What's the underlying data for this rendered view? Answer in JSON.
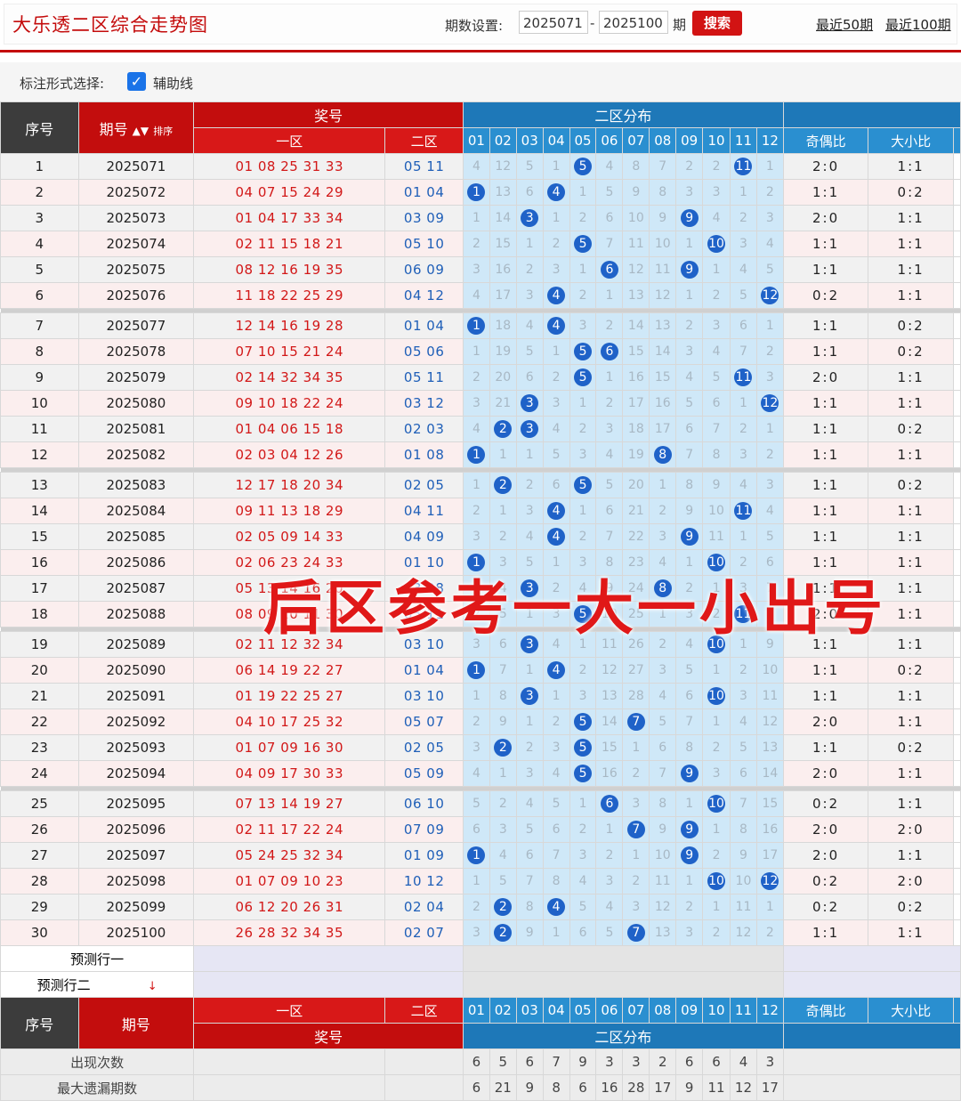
{
  "header": {
    "title": "大乐透二区综合走势图",
    "period_label": "期数设置:",
    "period_start": "2025071",
    "period_end": "2025100",
    "period_unit": "期",
    "search_label": "搜索",
    "quick_links": [
      "最近50期",
      "最近100期"
    ]
  },
  "options": {
    "label": "标注形式选择:",
    "checkbox_label": "辅助线",
    "checked": true
  },
  "table_header": {
    "seq": "序号",
    "period": "期号",
    "sort": "排序",
    "prize": "奖号",
    "zone1": "一区",
    "zone2": "二区",
    "dist": "二区分布",
    "numbers": [
      "01",
      "02",
      "03",
      "04",
      "05",
      "06",
      "07",
      "08",
      "09",
      "10",
      "11",
      "12"
    ],
    "odd_even": "奇偶比",
    "big_small": "大小比"
  },
  "rows": [
    {
      "seq": "1",
      "period": "2025071",
      "front": "01 08 25 31 33",
      "back": "05 11",
      "cells": [
        "4",
        "12",
        "5",
        "1",
        "●5",
        "4",
        "8",
        "7",
        "2",
        "2",
        "●11",
        "1"
      ],
      "oe": "2:0",
      "bs": "1:1"
    },
    {
      "seq": "2",
      "period": "2025072",
      "front": "04 07 15 24 29",
      "back": "01 04",
      "cells": [
        "●1",
        "13",
        "6",
        "●4",
        "1",
        "5",
        "9",
        "8",
        "3",
        "3",
        "1",
        "2"
      ],
      "oe": "1:1",
      "bs": "0:2"
    },
    {
      "seq": "3",
      "period": "2025073",
      "front": "01 04 17 33 34",
      "back": "03 09",
      "cells": [
        "1",
        "14",
        "●3",
        "1",
        "2",
        "6",
        "10",
        "9",
        "●9",
        "4",
        "2",
        "3"
      ],
      "oe": "2:0",
      "bs": "1:1"
    },
    {
      "seq": "4",
      "period": "2025074",
      "front": "02 11 15 18 21",
      "back": "05 10",
      "cells": [
        "2",
        "15",
        "1",
        "2",
        "●5",
        "7",
        "11",
        "10",
        "1",
        "●10",
        "3",
        "4"
      ],
      "oe": "1:1",
      "bs": "1:1"
    },
    {
      "seq": "5",
      "period": "2025075",
      "front": "08 12 16 19 35",
      "back": "06 09",
      "cells": [
        "3",
        "16",
        "2",
        "3",
        "1",
        "●6",
        "12",
        "11",
        "●9",
        "1",
        "4",
        "5"
      ],
      "oe": "1:1",
      "bs": "1:1"
    },
    {
      "seq": "6",
      "period": "2025076",
      "front": "11 18 22 25 29",
      "back": "04 12",
      "cells": [
        "4",
        "17",
        "3",
        "●4",
        "2",
        "1",
        "13",
        "12",
        "1",
        "2",
        "5",
        "●12"
      ],
      "oe": "0:2",
      "bs": "1:1"
    },
    {
      "seq": "7",
      "period": "2025077",
      "front": "12 14 16 19 28",
      "back": "01 04",
      "cells": [
        "●1",
        "18",
        "4",
        "●4",
        "3",
        "2",
        "14",
        "13",
        "2",
        "3",
        "6",
        "1"
      ],
      "oe": "1:1",
      "bs": "0:2"
    },
    {
      "seq": "8",
      "period": "2025078",
      "front": "07 10 15 21 24",
      "back": "05 06",
      "cells": [
        "1",
        "19",
        "5",
        "1",
        "●5",
        "●6",
        "15",
        "14",
        "3",
        "4",
        "7",
        "2"
      ],
      "oe": "1:1",
      "bs": "0:2"
    },
    {
      "seq": "9",
      "period": "2025079",
      "front": "02 14 32 34 35",
      "back": "05 11",
      "cells": [
        "2",
        "20",
        "6",
        "2",
        "●5",
        "1",
        "16",
        "15",
        "4",
        "5",
        "●11",
        "3"
      ],
      "oe": "2:0",
      "bs": "1:1"
    },
    {
      "seq": "10",
      "period": "2025080",
      "front": "09 10 18 22 24",
      "back": "03 12",
      "cells": [
        "3",
        "21",
        "●3",
        "3",
        "1",
        "2",
        "17",
        "16",
        "5",
        "6",
        "1",
        "●12"
      ],
      "oe": "1:1",
      "bs": "1:1"
    },
    {
      "seq": "11",
      "period": "2025081",
      "front": "01 04 06 15 18",
      "back": "02 03",
      "cells": [
        "4",
        "●2",
        "●3",
        "4",
        "2",
        "3",
        "18",
        "17",
        "6",
        "7",
        "2",
        "1"
      ],
      "oe": "1:1",
      "bs": "0:2"
    },
    {
      "seq": "12",
      "period": "2025082",
      "front": "02 03 04 12 26",
      "back": "01 08",
      "cells": [
        "●1",
        "1",
        "1",
        "5",
        "3",
        "4",
        "19",
        "●8",
        "7",
        "8",
        "3",
        "2"
      ],
      "oe": "1:1",
      "bs": "1:1"
    },
    {
      "seq": "13",
      "period": "2025083",
      "front": "12 17 18 20 34",
      "back": "02 05",
      "cells": [
        "1",
        "●2",
        "2",
        "6",
        "●5",
        "5",
        "20",
        "1",
        "8",
        "9",
        "4",
        "3"
      ],
      "oe": "1:1",
      "bs": "0:2"
    },
    {
      "seq": "14",
      "period": "2025084",
      "front": "09 11 13 18 29",
      "back": "04 11",
      "cells": [
        "2",
        "1",
        "3",
        "●4",
        "1",
        "6",
        "21",
        "2",
        "9",
        "10",
        "●11",
        "4"
      ],
      "oe": "1:1",
      "bs": "1:1"
    },
    {
      "seq": "15",
      "period": "2025085",
      "front": "02 05 09 14 33",
      "back": "04 09",
      "cells": [
        "3",
        "2",
        "4",
        "●4",
        "2",
        "7",
        "22",
        "3",
        "●9",
        "11",
        "1",
        "5"
      ],
      "oe": "1:1",
      "bs": "1:1"
    },
    {
      "seq": "16",
      "period": "2025086",
      "front": "02 06 23 24 33",
      "back": "01 10",
      "cells": [
        "●1",
        "3",
        "5",
        "1",
        "3",
        "8",
        "23",
        "4",
        "1",
        "●10",
        "2",
        "6"
      ],
      "oe": "1:1",
      "bs": "1:1"
    },
    {
      "seq": "17",
      "period": "2025087",
      "front": "05 13 14 16 20",
      "back": "03 08",
      "cells": [
        "1",
        "4",
        "●3",
        "2",
        "4",
        "9",
        "24",
        "●8",
        "2",
        "1",
        "3",
        "7"
      ],
      "oe": "1:1",
      "bs": "1:1"
    },
    {
      "seq": "18",
      "period": "2025088",
      "front": "08 09 10 11 30",
      "back": "05 11",
      "cells": [
        "2",
        "5",
        "1",
        "3",
        "●5",
        "10",
        "25",
        "1",
        "3",
        "2",
        "●11",
        "8"
      ],
      "oe": "2:0",
      "bs": "1:1"
    },
    {
      "seq": "19",
      "period": "2025089",
      "front": "02 11 12 32 34",
      "back": "03 10",
      "cells": [
        "3",
        "6",
        "●3",
        "4",
        "1",
        "11",
        "26",
        "2",
        "4",
        "●10",
        "1",
        "9"
      ],
      "oe": "1:1",
      "bs": "1:1"
    },
    {
      "seq": "20",
      "period": "2025090",
      "front": "06 14 19 22 27",
      "back": "01 04",
      "cells": [
        "●1",
        "7",
        "1",
        "●4",
        "2",
        "12",
        "27",
        "3",
        "5",
        "1",
        "2",
        "10"
      ],
      "oe": "1:1",
      "bs": "0:2"
    },
    {
      "seq": "21",
      "period": "2025091",
      "front": "01 19 22 25 27",
      "back": "03 10",
      "cells": [
        "1",
        "8",
        "●3",
        "1",
        "3",
        "13",
        "28",
        "4",
        "6",
        "●10",
        "3",
        "11"
      ],
      "oe": "1:1",
      "bs": "1:1"
    },
    {
      "seq": "22",
      "period": "2025092",
      "front": "04 10 17 25 32",
      "back": "05 07",
      "cells": [
        "2",
        "9",
        "1",
        "2",
        "●5",
        "14",
        "●7",
        "5",
        "7",
        "1",
        "4",
        "12"
      ],
      "oe": "2:0",
      "bs": "1:1"
    },
    {
      "seq": "23",
      "period": "2025093",
      "front": "01 07 09 16 30",
      "back": "02 05",
      "cells": [
        "3",
        "●2",
        "2",
        "3",
        "●5",
        "15",
        "1",
        "6",
        "8",
        "2",
        "5",
        "13"
      ],
      "oe": "1:1",
      "bs": "0:2"
    },
    {
      "seq": "24",
      "period": "2025094",
      "front": "04 09 17 30 33",
      "back": "05 09",
      "cells": [
        "4",
        "1",
        "3",
        "4",
        "●5",
        "16",
        "2",
        "7",
        "●9",
        "3",
        "6",
        "14"
      ],
      "oe": "2:0",
      "bs": "1:1"
    },
    {
      "seq": "25",
      "period": "2025095",
      "front": "07 13 14 19 27",
      "back": "06 10",
      "cells": [
        "5",
        "2",
        "4",
        "5",
        "1",
        "●6",
        "3",
        "8",
        "1",
        "●10",
        "7",
        "15"
      ],
      "oe": "0:2",
      "bs": "1:1"
    },
    {
      "seq": "26",
      "period": "2025096",
      "front": "02 11 17 22 24",
      "back": "07 09",
      "cells": [
        "6",
        "3",
        "5",
        "6",
        "2",
        "1",
        "●7",
        "9",
        "●9",
        "1",
        "8",
        "16"
      ],
      "oe": "2:0",
      "bs": "2:0"
    },
    {
      "seq": "27",
      "period": "2025097",
      "front": "05 24 25 32 34",
      "back": "01 09",
      "cells": [
        "●1",
        "4",
        "6",
        "7",
        "3",
        "2",
        "1",
        "10",
        "●9",
        "2",
        "9",
        "17"
      ],
      "oe": "2:0",
      "bs": "1:1"
    },
    {
      "seq": "28",
      "period": "2025098",
      "front": "01 07 09 10 23",
      "back": "10 12",
      "cells": [
        "1",
        "5",
        "7",
        "8",
        "4",
        "3",
        "2",
        "11",
        "1",
        "●10",
        "10",
        "●12"
      ],
      "oe": "0:2",
      "bs": "2:0"
    },
    {
      "seq": "29",
      "period": "2025099",
      "front": "06 12 20 26 31",
      "back": "02 04",
      "cells": [
        "2",
        "●2",
        "8",
        "●4",
        "5",
        "4",
        "3",
        "12",
        "2",
        "1",
        "11",
        "1"
      ],
      "oe": "0:2",
      "bs": "0:2"
    },
    {
      "seq": "30",
      "period": "2025100",
      "front": "26 28 32 34 35",
      "back": "02 07",
      "cells": [
        "3",
        "●2",
        "9",
        "1",
        "6",
        "5",
        "●7",
        "13",
        "3",
        "2",
        "12",
        "2"
      ],
      "oe": "1:1",
      "bs": "1:1"
    }
  ],
  "predict": [
    "预测行一",
    "预测行二"
  ],
  "stats": {
    "appear_label": "出现次数",
    "appear_values": [
      "6",
      "5",
      "6",
      "7",
      "9",
      "3",
      "3",
      "2",
      "6",
      "6",
      "4",
      "3"
    ],
    "max_miss_label": "最大遗漏期数",
    "max_miss_values": [
      "6",
      "21",
      "9",
      "8",
      "6",
      "16",
      "28",
      "17",
      "9",
      "11",
      "12",
      "17"
    ]
  },
  "watermark": "后区参考一大一小出号",
  "colors": {
    "brand_red": "#c40c0c",
    "header_blue": "#1e78b8",
    "ball_blue": "#1f62c8",
    "dist_bg": "#cfe8f8"
  }
}
